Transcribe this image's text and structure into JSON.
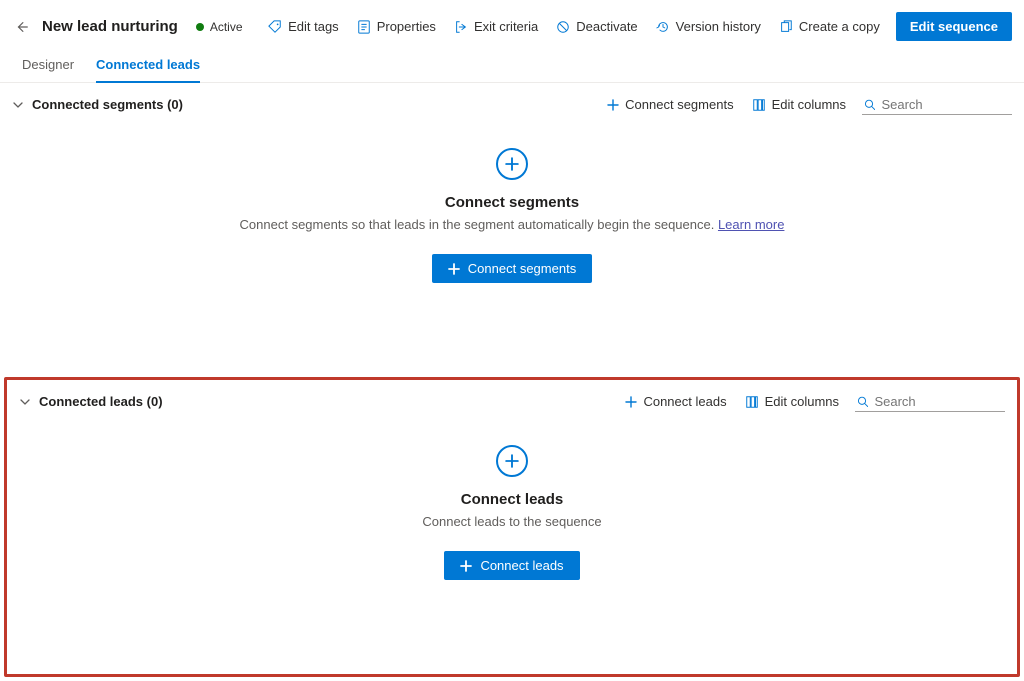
{
  "header": {
    "title": "New lead nurturing",
    "status_label": "Active",
    "commands": {
      "edit_tags": "Edit tags",
      "properties": "Properties",
      "exit_criteria": "Exit criteria",
      "deactivate": "Deactivate",
      "version_history": "Version history",
      "create_copy": "Create a copy",
      "edit_sequence": "Edit sequence"
    }
  },
  "tabs": {
    "designer": "Designer",
    "connected_leads": "Connected leads"
  },
  "segments": {
    "section_title": "Connected segments (0)",
    "toolbar": {
      "connect": "Connect segments",
      "edit_columns": "Edit columns",
      "search_placeholder": "Search"
    },
    "empty": {
      "title": "Connect segments",
      "desc": "Connect segments so that leads in the segment automatically begin the sequence. ",
      "learn_more": "Learn more",
      "button": "Connect segments"
    }
  },
  "leads": {
    "section_title": "Connected leads (0)",
    "toolbar": {
      "connect": "Connect leads",
      "edit_columns": "Edit columns",
      "search_placeholder": "Search"
    },
    "empty": {
      "title": "Connect leads",
      "desc": "Connect leads to the sequence",
      "button": "Connect leads"
    }
  }
}
